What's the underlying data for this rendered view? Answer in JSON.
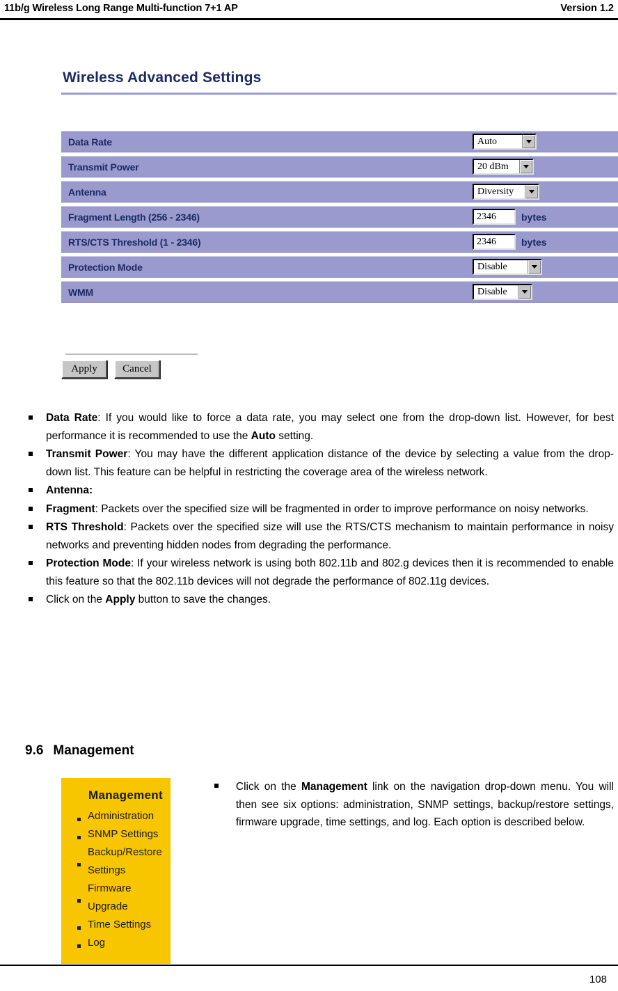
{
  "header": {
    "title": "11b/g Wireless Long Range Multi-function 7+1 AP",
    "version": "Version 1.2"
  },
  "panel": {
    "title": "Wireless Advanced Settings"
  },
  "settings": {
    "rows": [
      {
        "label": "Data Rate",
        "control": "select",
        "value": "Auto"
      },
      {
        "label": "Transmit Power",
        "control": "select",
        "value": "20 dBm"
      },
      {
        "label": "Antenna",
        "control": "select",
        "value": "Diversity"
      },
      {
        "label": "Fragment Length (256 - 2346)",
        "control": "text",
        "value": "2346",
        "unit": "bytes"
      },
      {
        "label": "RTS/CTS Threshold (1 - 2346)",
        "control": "text",
        "value": "2346",
        "unit": "bytes"
      },
      {
        "label": "Protection Mode",
        "control": "select",
        "value": "Disable"
      },
      {
        "label": "WMM",
        "control": "select",
        "value": "Disable"
      }
    ]
  },
  "buttons": {
    "apply": "Apply",
    "cancel": "Cancel"
  },
  "bullets": [
    {
      "term": "Data Rate",
      "sep": ": ",
      "text": "If you would like to force a data rate, you may select one from the drop-down list. However, for best performance it is recommended to use the ",
      "bold_tail": "Auto",
      "tail": " setting."
    },
    {
      "term": "Transmit Power",
      "sep": ": ",
      "text": "You may have the different application distance of the device by selecting a value from the drop-down list. This feature can be helpful in restricting the coverage area of the wireless network.",
      "bold_tail": "",
      "tail": ""
    },
    {
      "term": "Antenna:",
      "sep": "",
      "text": "",
      "bold_tail": "",
      "tail": ""
    },
    {
      "term": "Fragment",
      "sep": ": ",
      "text": "Packets over the specified size will be fragmented in order to improve performance on noisy networks.",
      "bold_tail": "",
      "tail": ""
    },
    {
      "term": "RTS Threshold",
      "sep": ": ",
      "text": "Packets over the specified size will use the RTS/CTS mechanism to maintain performance in noisy networks and preventing hidden nodes from degrading the performance.",
      "bold_tail": "",
      "tail": ""
    },
    {
      "term": "Protection Mode",
      "sep": ": ",
      "text": "If your wireless network is using both 802.11b and 802.g devices then it is recommended to enable this feature so that the 802.11b devices will not degrade the performance of 802.11g devices.",
      "bold_tail": "",
      "tail": ""
    },
    {
      "term": "",
      "sep": "",
      "text": "Click on the ",
      "bold_tail": "Apply",
      "tail": " button to save the changes."
    }
  ],
  "section": {
    "number": "9.6",
    "title": "Management"
  },
  "management_menu": {
    "title": "Management",
    "items": [
      "Administration",
      "SNMP Settings",
      "Backup/Restore Settings",
      "Firmware Upgrade",
      "Time Settings",
      "Log"
    ]
  },
  "management_note": {
    "lead": "Click on the ",
    "bold": "Management",
    "tail": " link on the navigation drop-down menu. You will then see six options: administration, SNMP settings, backup/restore settings, firmware upgrade, time settings, and log. Each option is described below."
  },
  "footer": {
    "page_number": "108"
  },
  "colors": {
    "row_background": "#9a9ace",
    "panel_accent": "#9a9ad6",
    "title_text": "#1b2a63",
    "menu_background": "#f7c600"
  }
}
